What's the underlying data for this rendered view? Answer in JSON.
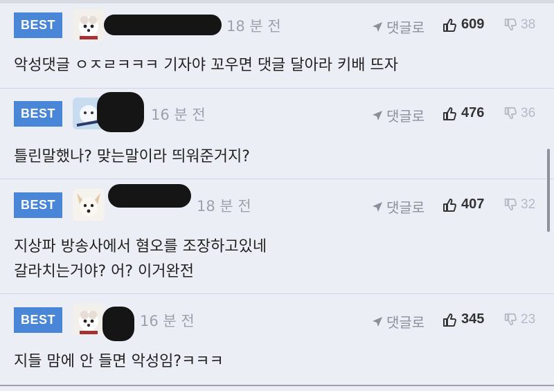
{
  "comments": [
    {
      "badge": "BEST",
      "time": "18 분 전",
      "reply_label": "댓글로",
      "likes": "609",
      "dislikes": "38",
      "text": "악성댓글 ㅇㅈㄹㅋㅋㅋ 기자야 꼬우면 댓글 달아라 키배 뜨자"
    },
    {
      "badge": "BEST",
      "time": "16 분 전",
      "reply_label": "댓글로",
      "likes": "476",
      "dislikes": "36",
      "text": "틀린말했나? 맞는말이라 띄워준거지?"
    },
    {
      "badge": "BEST",
      "time": "18 분 전",
      "reply_label": "댓글로",
      "likes": "407",
      "dislikes": "32",
      "text": "지상파 방송사에서 혐오를 조장하고있네\n갈라치는거야? 어? 이거완전"
    },
    {
      "badge": "BEST",
      "time": "16 분 전",
      "reply_label": "댓글로",
      "likes": "345",
      "dislikes": "23",
      "text": "지들 맘에 안 들면 악성임?ㅋㅋㅋ"
    }
  ],
  "colors": {
    "background": "#eceef6",
    "best_badge": "#4a86d8",
    "muted_text": "#9da1ab",
    "censor_bar": "#151515"
  },
  "icons": {
    "reply": "reply-arrow-icon",
    "like": "thumbs-up-icon",
    "dislike": "thumbs-down-icon"
  }
}
